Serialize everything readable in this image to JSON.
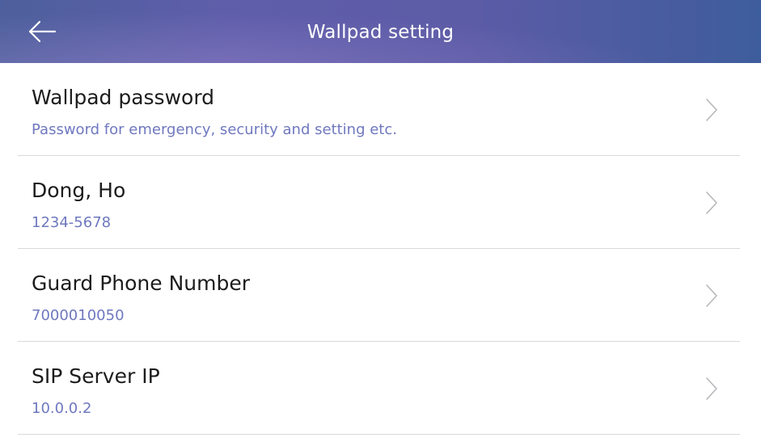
{
  "header": {
    "title": "Wallpad setting",
    "back_icon": "arrow-left-icon"
  },
  "colors": {
    "header_gradient": [
      "#4d5f9c",
      "#5f5eaa",
      "#5c5ba6",
      "#3e5d9c"
    ],
    "title_text": "#1c1c1c",
    "subtitle_text": "#6f78bf",
    "chevron": "#b8b8bc",
    "divider": "#d9d9dd"
  },
  "settings": {
    "items": [
      {
        "title": "Wallpad password",
        "subtitle": "Password for emergency, security and setting etc.",
        "icon": "chevron-right-icon"
      },
      {
        "title": "Dong, Ho",
        "subtitle": "1234-5678",
        "icon": "chevron-right-icon"
      },
      {
        "title": "Guard Phone Number",
        "subtitle": "7000010050",
        "icon": "chevron-right-icon"
      },
      {
        "title": "SIP Server IP",
        "subtitle": "10.0.0.2",
        "icon": "chevron-right-icon"
      }
    ]
  }
}
